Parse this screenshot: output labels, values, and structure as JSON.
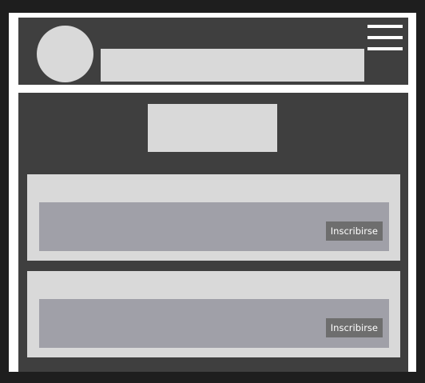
{
  "cards": [
    {
      "button_label": "Inscribirse"
    },
    {
      "button_label": "Inscribirse"
    }
  ],
  "colors": {
    "background": "#1e1e1e",
    "frame": "#ffffff",
    "panel": "#3f3f3f",
    "placeholder": "#d9d9d9",
    "card_inner": "#a0a0a8",
    "button": "#6e6e6e"
  },
  "icons": {
    "menu": "hamburger-menu-icon",
    "avatar": "avatar-placeholder"
  }
}
